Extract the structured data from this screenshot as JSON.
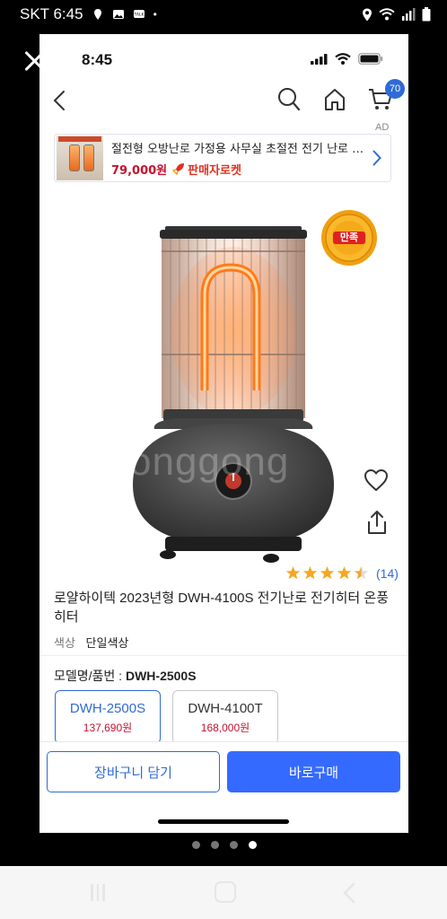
{
  "android_status": {
    "carrier_time": "SKT 6:45",
    "left_icons": [
      "location-pin-icon",
      "image-icon",
      "talk-icon"
    ],
    "dot": "•",
    "right_icons": [
      "location-icon",
      "wifi-icon",
      "signal-icon",
      "battery-icon"
    ]
  },
  "ios_status": {
    "time": "8:45",
    "icons": [
      "cellular-icon",
      "wifi-icon",
      "battery-icon"
    ]
  },
  "navbar": {
    "icons": [
      "back-icon",
      "search-icon",
      "home-icon",
      "cart-icon"
    ],
    "cart_badge": "70"
  },
  "ad": {
    "label": "AD",
    "title": "절전형 오방난로 가정용 사무실 초절전 전기 난로 히터",
    "price": "79,000원",
    "rocket_label": "판매자로켓"
  },
  "product": {
    "satisfaction_badge": "만족",
    "watermark": "onggong",
    "rating": 4.5,
    "review_count": "(14)",
    "title": "로얄하이텍 2023년형 DWH-4100S 전기난로 전기히터 온풍히터",
    "color_label": "색상",
    "color_value": "단일색상",
    "model_label": "모델명/품번 : ",
    "model_value": "DWH-2500S"
  },
  "options": [
    {
      "name": "DWH-2500S",
      "price": "137,690원",
      "selected": true
    },
    {
      "name": "DWH-4100T",
      "price": "168,000원",
      "selected": false
    }
  ],
  "buttons": {
    "cart": "장바구니 담기",
    "buy": "바로구매"
  },
  "pager": {
    "count": 4,
    "active": 4
  },
  "colors": {
    "accent": "#346aff",
    "link": "#2f6bd6",
    "price_red": "#c8102e",
    "star": "#f5a623"
  }
}
